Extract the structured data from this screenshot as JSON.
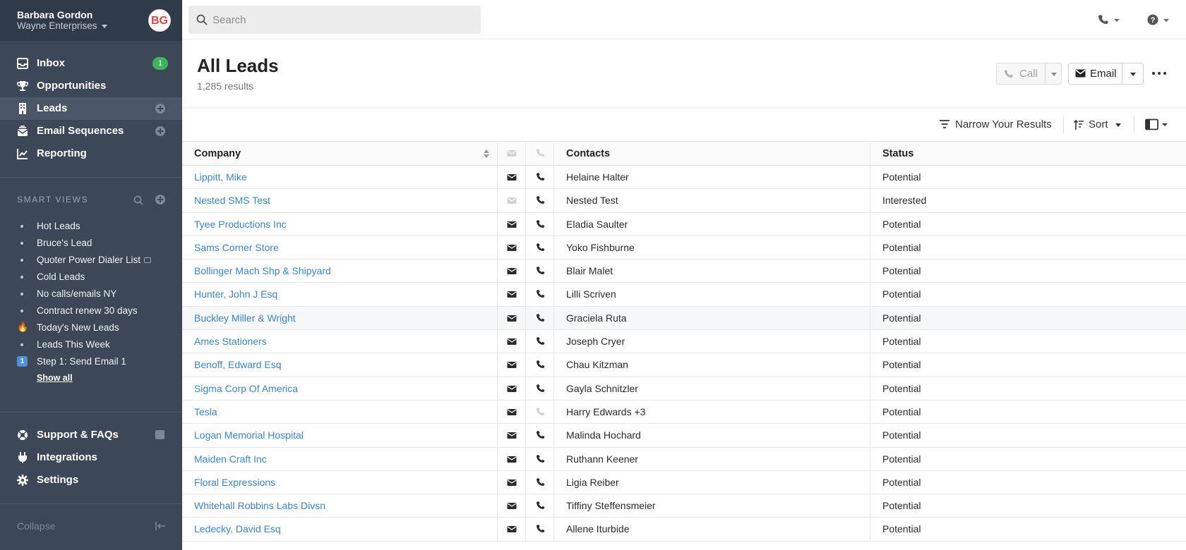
{
  "user": {
    "name": "Barbara Gordon",
    "org": "Wayne Enterprises",
    "initials": "BG"
  },
  "nav": [
    {
      "label": "Inbox",
      "icon": "inbox-icon",
      "badge": "1"
    },
    {
      "label": "Opportunities",
      "icon": "trophy-icon"
    },
    {
      "label": "Leads",
      "icon": "building-icon",
      "active": true
    },
    {
      "label": "Email Sequences",
      "icon": "envelope-stack-icon"
    },
    {
      "label": "Reporting",
      "icon": "chart-icon"
    }
  ],
  "smart_views": {
    "heading": "SMART VIEWS",
    "items": [
      {
        "label": "Hot Leads",
        "marker": "bullet"
      },
      {
        "label": "Bruce's Lead",
        "marker": "bullet"
      },
      {
        "label": "Quoter Power Dialer List",
        "marker": "bullet",
        "locked": true
      },
      {
        "label": "Cold Leads",
        "marker": "bullet"
      },
      {
        "label": "No calls/emails NY",
        "marker": "bullet"
      },
      {
        "label": "Contract renew 30 days",
        "marker": "bullet"
      },
      {
        "label": "Today's New Leads",
        "marker": "🔥"
      },
      {
        "label": "Leads This Week",
        "marker": "bullet"
      },
      {
        "label": "Step 1: Send Email 1",
        "marker": "1"
      }
    ],
    "show_all": "Show all"
  },
  "bottom_nav": [
    {
      "label": "Support & FAQs",
      "icon": "lifebuoy-icon"
    },
    {
      "label": "Integrations",
      "icon": "plug-icon"
    },
    {
      "label": "Settings",
      "icon": "gear-icon"
    }
  ],
  "collapse_label": "Collapse",
  "search": {
    "placeholder": "Search"
  },
  "page": {
    "title": "All Leads",
    "results": "1,285 results"
  },
  "actions": {
    "call": "Call",
    "email": "Email"
  },
  "filters": {
    "narrow": "Narrow Your Results",
    "sort": "Sort"
  },
  "table": {
    "headers": {
      "company": "Company",
      "contacts": "Contacts",
      "status": "Status"
    },
    "rows": [
      {
        "company": "Lippitt, Mike",
        "contacts": "Helaine Halter",
        "status": "Potential",
        "mail": true,
        "phone": true
      },
      {
        "company": "Nested SMS Test",
        "contacts": "Nested Test",
        "status": "Interested",
        "mail": false,
        "phone": true
      },
      {
        "company": "Tyee Productions Inc",
        "contacts": "Eladia Saulter",
        "status": "Potential",
        "mail": true,
        "phone": true
      },
      {
        "company": "Sams Corner Store",
        "contacts": "Yoko Fishburne",
        "status": "Potential",
        "mail": true,
        "phone": true
      },
      {
        "company": "Bollinger Mach Shp & Shipyard",
        "contacts": "Blair Malet",
        "status": "Potential",
        "mail": true,
        "phone": true
      },
      {
        "company": "Hunter, John J Esq",
        "contacts": "Lilli Scriven",
        "status": "Potential",
        "mail": true,
        "phone": true
      },
      {
        "company": "Buckley Miller & Wright",
        "contacts": "Graciela Ruta",
        "status": "Potential",
        "mail": true,
        "phone": true,
        "highlight": true
      },
      {
        "company": "Ames Stationers",
        "contacts": "Joseph Cryer",
        "status": "Potential",
        "mail": true,
        "phone": true
      },
      {
        "company": "Benoff, Edward Esq",
        "contacts": "Chau Kitzman",
        "status": "Potential",
        "mail": true,
        "phone": true
      },
      {
        "company": "Sigma Corp Of America",
        "contacts": "Gayla Schnitzler",
        "status": "Potential",
        "mail": true,
        "phone": true
      },
      {
        "company": "Tesla",
        "contacts": "Harry Edwards +3",
        "status": "Potential",
        "mail": true,
        "phone": false
      },
      {
        "company": "Logan Memorial Hospital",
        "contacts": "Malinda Hochard",
        "status": "Potential",
        "mail": true,
        "phone": true
      },
      {
        "company": "Maiden Craft Inc",
        "contacts": "Ruthann Keener",
        "status": "Potential",
        "mail": true,
        "phone": true
      },
      {
        "company": "Floral Expressions",
        "contacts": "Ligia Reiber",
        "status": "Potential",
        "mail": true,
        "phone": true
      },
      {
        "company": "Whitehall Robbins Labs Divsn",
        "contacts": "Tiffiny Steffensmeier",
        "status": "Potential",
        "mail": true,
        "phone": true
      },
      {
        "company": "Ledecky, David Esq",
        "contacts": "Allene Iturbide",
        "status": "Potential",
        "mail": true,
        "phone": true
      }
    ]
  },
  "colors": {
    "sidebar": "#3c4858",
    "link": "#3a86c8",
    "badge": "#3fb45e",
    "avatar_text": "#d9463d"
  }
}
